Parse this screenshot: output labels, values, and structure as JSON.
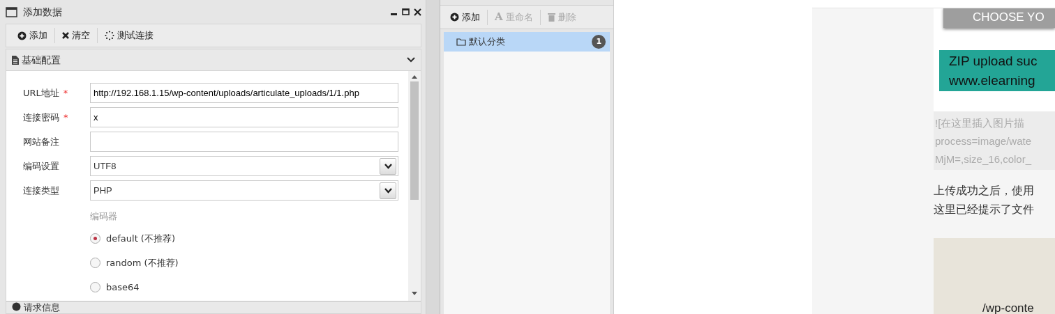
{
  "dialog": {
    "title": "添加数据",
    "toolbar": [
      {
        "label": "添加"
      },
      {
        "label": "清空"
      },
      {
        "label": "测试连接"
      }
    ],
    "section": {
      "title": "基础配置",
      "expanded": true
    },
    "fields": [
      {
        "label": "URL地址",
        "required_mark": "*",
        "kind": "text",
        "value": "http://192.168.1.15/wp-content/uploads/articulate_uploads/1/1.php"
      },
      {
        "label": "连接密码",
        "required_mark": "*",
        "kind": "text",
        "value": "x"
      },
      {
        "label": "网站备注",
        "kind": "text"
      },
      {
        "label": "编码设置",
        "kind": "select",
        "value": "UTF8"
      },
      {
        "label": "连接类型",
        "kind": "select",
        "value": "PHP"
      }
    ],
    "encoder": {
      "label": "编码器",
      "options": [
        {
          "label": "default (不推荐)",
          "selected": true
        },
        {
          "label": "random (不推荐)",
          "selected": false
        },
        {
          "label": "base64",
          "selected": false
        }
      ]
    },
    "next_section": {
      "title": "请求信息"
    }
  },
  "category_panel": {
    "toolbar": [
      {
        "label": "添加",
        "disabled": false
      },
      {
        "label": "重命名",
        "icon_text": "A",
        "disabled": true
      },
      {
        "label": "删除",
        "disabled": true
      }
    ],
    "items": [
      {
        "label": "默认分类",
        "count": "1",
        "selected": true
      }
    ]
  },
  "browser": {
    "button": "CHOOSE YO",
    "notice_lines": [
      "ZIP upload suc",
      "www.elearning"
    ],
    "code_lines": [
      "![在这里插入图片描",
      "process=image/wate",
      "MjM=,size_16,color_"
    ],
    "paragraph_lines": [
      "上传成功之后，使用",
      "这里已经提示了文件"
    ],
    "image_caption": "/wp-conte"
  }
}
